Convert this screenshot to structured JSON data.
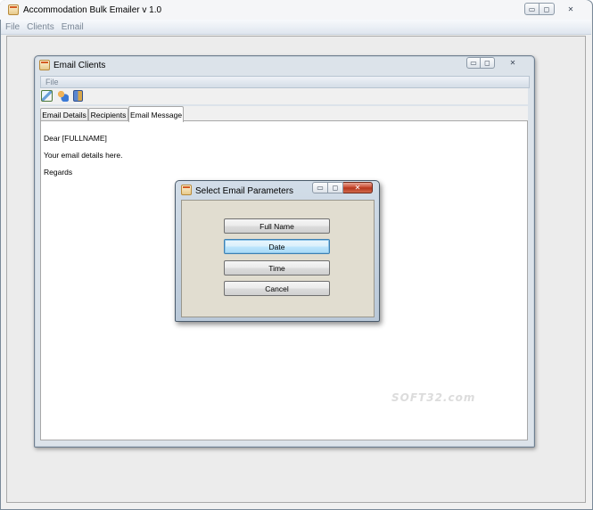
{
  "main_window": {
    "title": "Accommodation Bulk Emailer v 1.0",
    "menu": [
      "File",
      "Clients",
      "Email"
    ],
    "controls": {
      "minimize": "▭",
      "maximize": "◻",
      "close": "✕"
    }
  },
  "child_window": {
    "title": "Email Clients",
    "menu": [
      "File"
    ],
    "toolbar": [
      "save-icon",
      "clients-icon",
      "exit-door-icon"
    ],
    "tabs": [
      "Email Details",
      "Recipients",
      "Email Message"
    ],
    "active_tab": "Email Message",
    "message_lines": [
      "Dear [FULLNAME]",
      "Your email details here.",
      "Regards"
    ],
    "controls": {
      "minimize": "▭",
      "maximize": "◻",
      "close": "✕"
    }
  },
  "dialog": {
    "title": "Select Email Parameters",
    "buttons": [
      "Full Name",
      "Date",
      "Time",
      "Cancel"
    ],
    "focused_button": "Date",
    "controls": {
      "minimize": "▭",
      "maximize": "◻",
      "close": "✕"
    }
  },
  "watermark": "SOFT32.com",
  "colors": {
    "menu_text": "#7a8796",
    "dialog_body": "#e1ddd0",
    "focused_button": "#a7d9f5",
    "close_button": "#c7452b"
  }
}
